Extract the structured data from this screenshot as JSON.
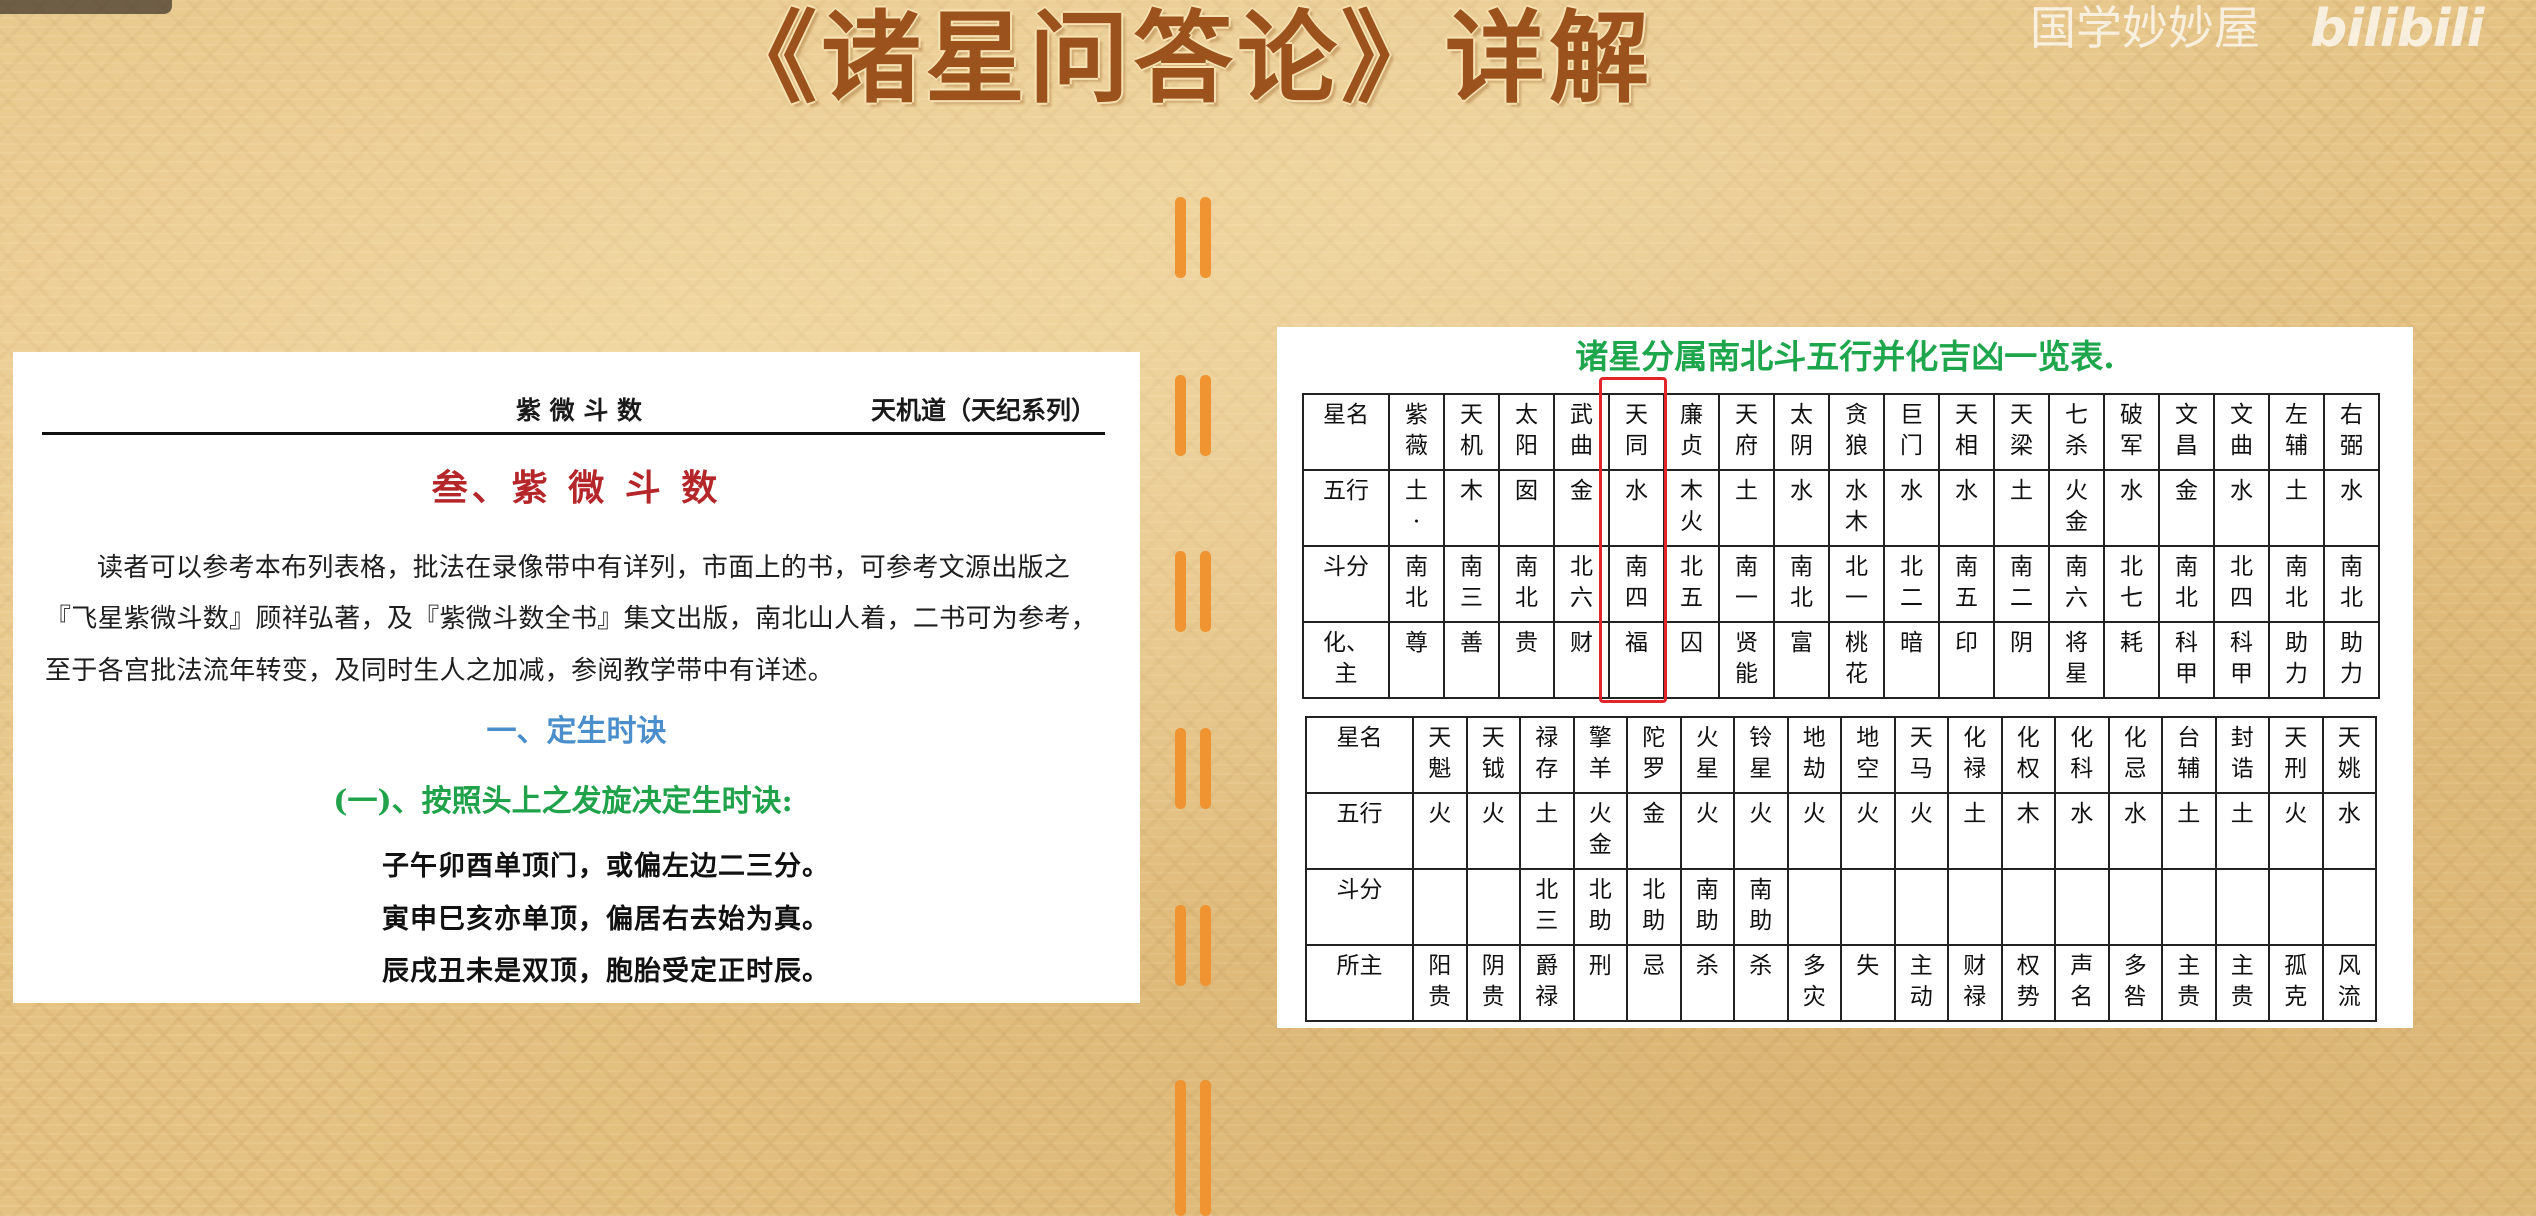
{
  "video": {
    "title": "《诸星问答论》详解",
    "watermark_channel": "国学妙妙屋",
    "watermark_logo": "bilibili"
  },
  "document": {
    "header_left": "紫 微 斗 数",
    "header_right": "天机道（天纪系列）",
    "heading": "叁、紫 微 斗 数",
    "paragraph_lines": [
      "读者可以参考本布列表格，批法在录像带中有详列，市面上的书，可参考文源出版之",
      "『飞星紫微斗数』顾祥弘著，及『紫微斗数全书』集文出版，南北山人着，二书可为参考，",
      "至于各宫批法流年转变，及同时生人之加减，参阅教学带中有详述。"
    ],
    "subheading": "一、定生时诀",
    "section_title": "(一)、按照头上之发旋决定生时诀:",
    "verses": [
      "子午卯酉单顶门，或偏左边二三分。",
      "寅申巳亥亦单顶，偏居右去始为真。",
      "辰戌丑未是双顶，胞胎受定正时辰。"
    ]
  },
  "star_table": {
    "title": "诸星分属南北斗五行并化吉凶一览表.",
    "highlight_color": "#E0262B",
    "table1": [
      {
        "label": "星名",
        "cells": [
          "紫薇",
          "天机",
          "太阳",
          "武曲",
          "天同",
          "廉贞",
          "天府",
          "太阴",
          "贪狼",
          "巨门",
          "天相",
          "天梁",
          "七杀",
          "破军",
          "文昌",
          "文曲",
          "左辅",
          "右弼"
        ]
      },
      {
        "label": "五行",
        "cells": [
          "土·",
          "木",
          "囡",
          "金",
          "水",
          "木火",
          "土",
          "水",
          "水木",
          "水",
          "水",
          "土",
          "火金",
          "水",
          "金",
          "水",
          "土",
          "水"
        ]
      },
      {
        "label": "斗分",
        "cells": [
          "南北",
          "南三",
          "南北",
          "北六",
          "南四",
          "北五",
          "南一",
          "南北",
          "北一",
          "北二",
          "南五",
          "南二",
          "南六",
          "北七",
          "南北",
          "北四",
          "南北",
          "南北"
        ]
      },
      {
        "label": "化、主",
        "cells": [
          "尊",
          "善",
          "贵",
          "财",
          "福",
          "囚",
          "贤能",
          "富",
          "桃花",
          "暗",
          "印",
          "阴",
          "将星",
          "耗",
          "科甲",
          "科甲",
          "助力",
          "助力"
        ]
      }
    ],
    "table2": [
      {
        "label": "星名",
        "cells": [
          "天魁",
          "天钺",
          "禄存",
          "擎羊",
          "陀罗",
          "火星",
          "铃星",
          "地劫",
          "地空",
          "天马",
          "化禄",
          "化权",
          "化科",
          "化忌",
          "台辅",
          "封诰",
          "天刑",
          "天姚"
        ]
      },
      {
        "label": "五行",
        "cells": [
          "火",
          "火",
          "土",
          "火金",
          "金",
          "火",
          "火",
          "火",
          "火",
          "火",
          "土",
          "木",
          "水",
          "水",
          "土",
          "土",
          "火",
          "水"
        ]
      },
      {
        "label": "斗分",
        "cells": [
          "",
          "",
          "北三",
          "北助",
          "北助",
          "南助",
          "南助",
          "",
          "",
          "",
          "",
          "",
          "",
          "",
          "",
          "",
          "",
          ""
        ]
      },
      {
        "label": "所主",
        "cells": [
          "阳贵",
          "阴贵",
          "爵禄",
          "刑",
          "忌",
          "杀",
          "杀",
          "多灾",
          "失",
          "主动",
          "财禄",
          "权势",
          "声名",
          "多咎",
          "主贵",
          "主贵",
          "孤克",
          "风流"
        ]
      }
    ]
  }
}
